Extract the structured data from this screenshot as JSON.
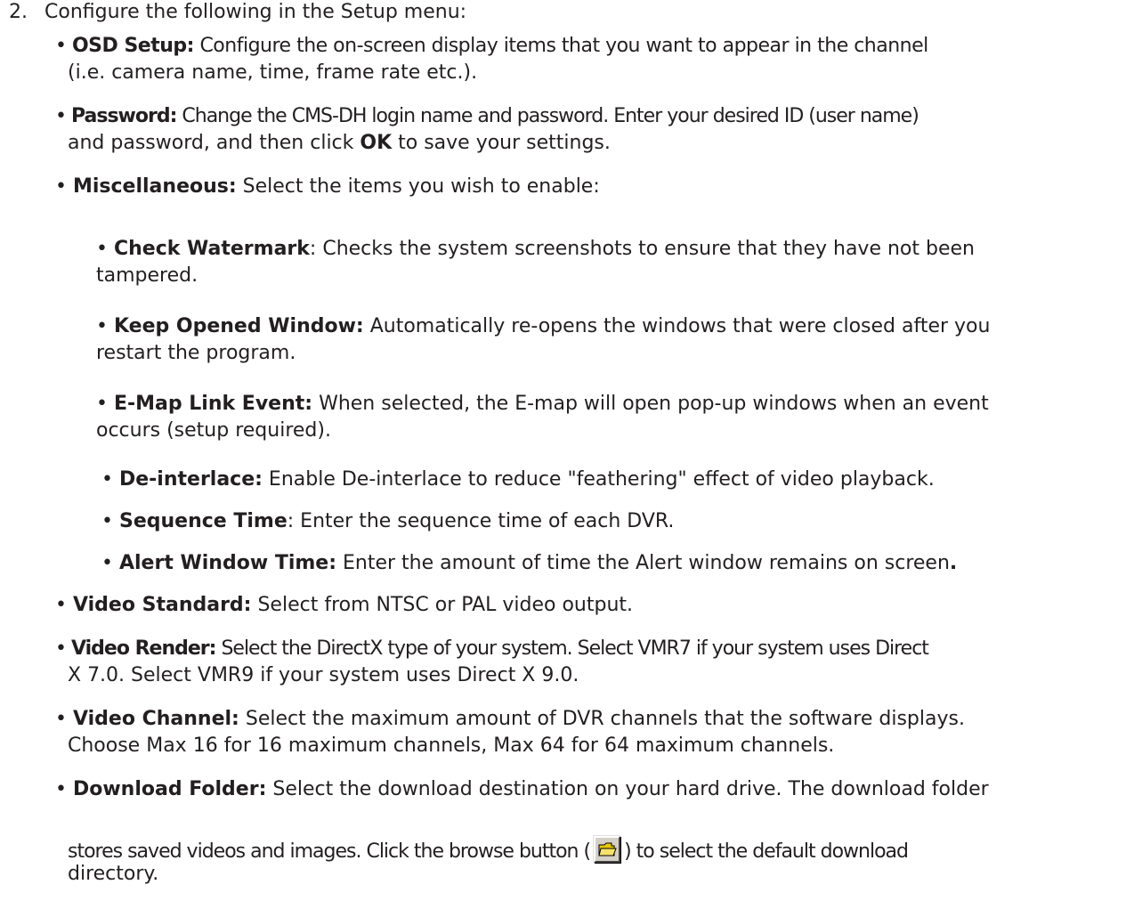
{
  "step": {
    "number": "2.",
    "heading": "Configure the following in the Setup menu:"
  },
  "items": {
    "osd": {
      "bullet": "•",
      "term": "OSD Setup:",
      "line1": " Configure the on-screen display items that you want to appear in the channel",
      "line2": "(i.e. camera name, time, frame rate etc.)."
    },
    "password": {
      "bullet": "•",
      "term": "Password:",
      "line1": " Change the CMS-DH login name and password. Enter your desired ID (user name)",
      "line2a": "and password, and then click ",
      "ok": "OK",
      "line2b": " to save your settings."
    },
    "misc": {
      "bullet": "•",
      "term": "Miscellaneous:",
      "text": " Select the items you wish to enable:",
      "sub": {
        "watermark": {
          "bullet": "•",
          "term": "Check Watermark",
          "line1": ": Checks the system screenshots to ensure that they have not been",
          "line2": "tampered."
        },
        "keep": {
          "bullet": "•",
          "term": "Keep Opened Window:",
          "line1": " Automatically re-opens the windows that were closed after you",
          "line2": "restart the program."
        },
        "emap": {
          "bullet": "•",
          "term": "E-Map Link Event:",
          "line1": " When selected, the E-map will open pop-up windows when an event",
          "line2": "occurs (setup required)."
        },
        "deinterlace": {
          "bullet": "•",
          "term": "De-interlace:",
          "line1": " Enable De-interlace to reduce \"feathering\" effect of video playback."
        },
        "sequence": {
          "bullet": "•",
          "term": "Sequence Time",
          "line1": ": Enter the sequence time of each DVR."
        },
        "alert": {
          "bullet": "•",
          "term": "Alert Window Time:",
          "line1": " Enter the amount of time the Alert window remains on screen",
          "period": "."
        }
      }
    },
    "standard": {
      "bullet": "•",
      "term": "Video Standard:",
      "line1": " Select from NTSC or PAL video output."
    },
    "render": {
      "bullet": "•",
      "term": "Video Render:",
      "line1": " Select the DirectX type of your system. Select VMR7 if your system uses Direct",
      "line2": "X 7.0. Select VMR9 if your system uses Direct X 9.0."
    },
    "channel": {
      "bullet": "•",
      "term": "Video Channel:",
      "line1": " Select the maximum amount of DVR channels that the software displays.",
      "line2": "Choose Max 16 for 16 maximum channels, Max 64 for 64 maximum channels."
    },
    "download": {
      "bullet": "•",
      "term": "Download Folder:",
      "line1": " Select the download destination on your hard drive. The download folder",
      "line2a": "stores saved videos and images. Click the browse button (",
      "line2b": ") to select the default download",
      "line3": "directory."
    }
  },
  "icons": {
    "browse": "folder-icon",
    "folder_color": "#e8c800"
  }
}
